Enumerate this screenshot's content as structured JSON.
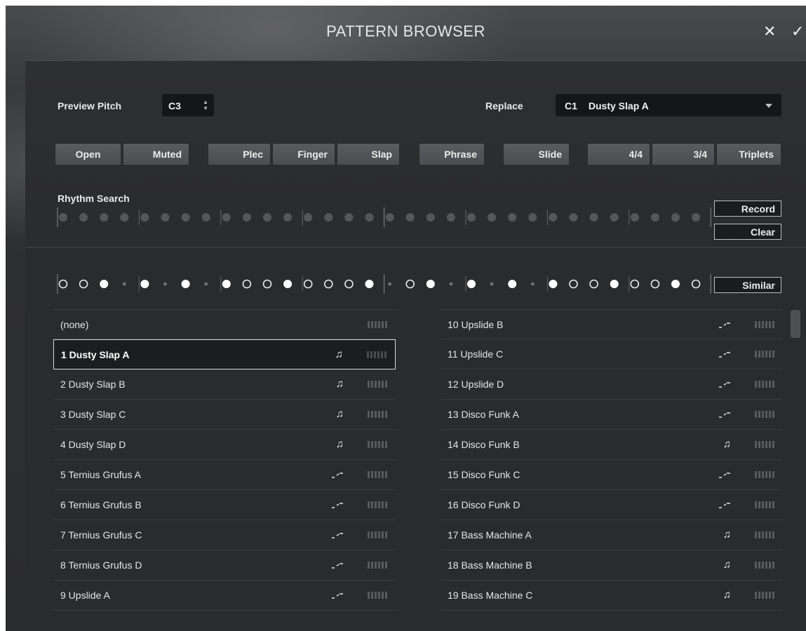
{
  "window": {
    "title": "PATTERN BROWSER",
    "close_glyph": "✕",
    "confirm_glyph": "✓"
  },
  "controls": {
    "preview_pitch_label": "Preview Pitch",
    "preview_pitch_value": "C3",
    "replace_label": "Replace",
    "replace_key": "C1",
    "replace_value": "Dusty Slap A"
  },
  "buttons": [
    "Open",
    "Muted",
    "Plec",
    "Finger",
    "Slap",
    "Phrase",
    "Slide",
    "4/4",
    "3/4",
    "Triplets"
  ],
  "rhythm_search": {
    "label": "Rhythm Search",
    "record_label": "Record",
    "clear_label": "Clear",
    "steps": "0000000000000000000000000000000"
  },
  "similar": {
    "label": "Similar",
    "steps": "ooO.O.O.OooOoooO.oO.O.O.OooOooOo"
  },
  "patterns_left": [
    {
      "name": "(none)",
      "icon": ""
    },
    {
      "name": "1  Dusty Slap A",
      "icon": "note",
      "selected": true
    },
    {
      "name": "2  Dusty Slap B",
      "icon": "note"
    },
    {
      "name": "3  Dusty Slap C",
      "icon": "note"
    },
    {
      "name": "4  Dusty Slap D",
      "icon": "note"
    },
    {
      "name": "5  Ternius Grufus A",
      "icon": "slide"
    },
    {
      "name": "6  Ternius Grufus B",
      "icon": "slide"
    },
    {
      "name": "7  Ternius Grufus C",
      "icon": "slide"
    },
    {
      "name": "8  Ternius Grufus D",
      "icon": "slide"
    },
    {
      "name": "9  Upslide A",
      "icon": "slide"
    }
  ],
  "patterns_right": [
    {
      "name": "10  Upslide B",
      "icon": "slide"
    },
    {
      "name": "11  Upslide C",
      "icon": "slide"
    },
    {
      "name": "12  Upslide D",
      "icon": "slide"
    },
    {
      "name": "13  Disco Funk A",
      "icon": "slide"
    },
    {
      "name": "14  Disco Funk B",
      "icon": "note"
    },
    {
      "name": "15  Disco Funk C",
      "icon": "slide"
    },
    {
      "name": "16  Disco Funk D",
      "icon": "slide"
    },
    {
      "name": "17  Bass Machine A",
      "icon": "note"
    },
    {
      "name": "18  Bass Machine B",
      "icon": "note"
    },
    {
      "name": "19  Bass Machine C",
      "icon": "note"
    }
  ],
  "icons": {
    "note": "♫",
    "slide": "slide-icon"
  }
}
